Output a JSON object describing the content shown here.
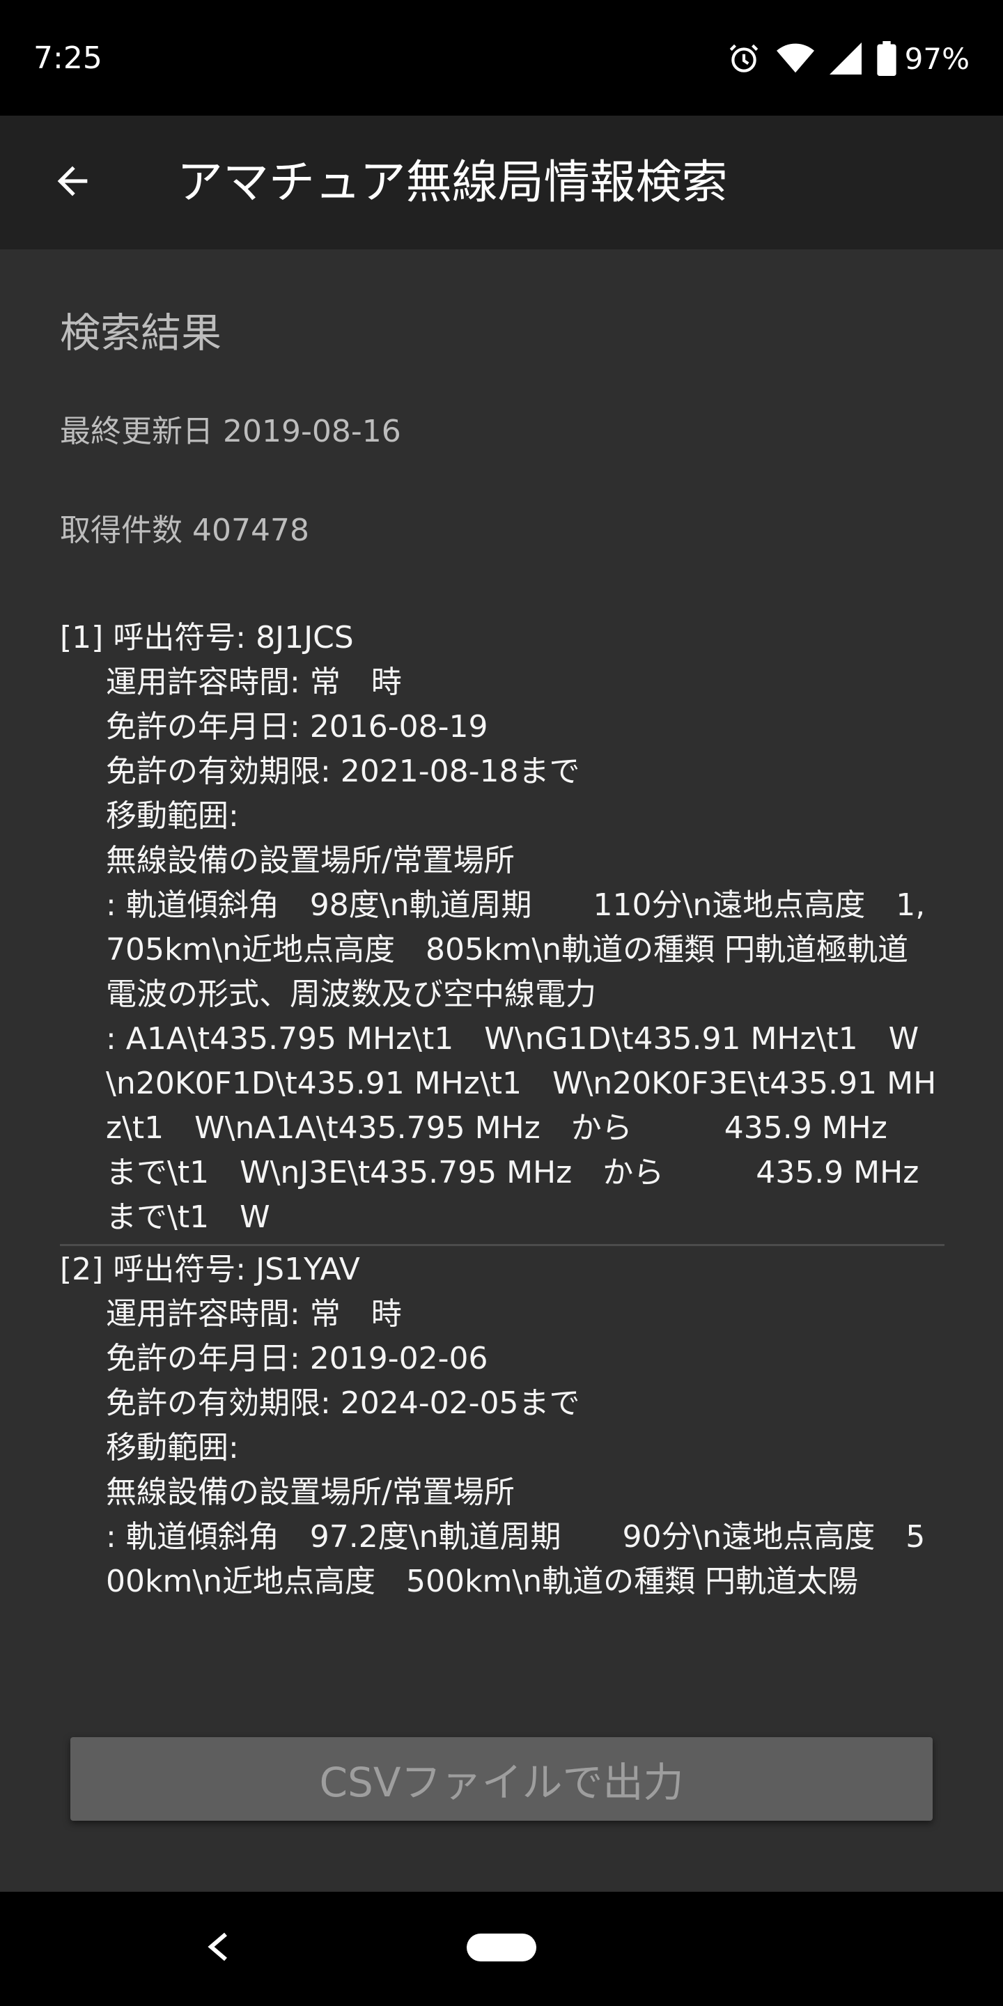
{
  "status_bar": {
    "time": "7:25",
    "battery_percent": "97%",
    "icons": [
      "alarm-icon",
      "wifi-icon",
      "cell-signal-icon",
      "battery-icon"
    ]
  },
  "app_bar": {
    "title": "アマチュア無線局情報検索",
    "back_icon": "arrow-back-icon"
  },
  "content": {
    "section_title": "検索結果",
    "last_updated": "最終更新日 2019-08-16",
    "result_count": "取得件数 407478"
  },
  "results": [
    {
      "header": "[1] 呼出符号: 8J1JCS",
      "operating_hours": "運用許容時間: 常　時",
      "license_date": "免許の年月日: 2016-08-19",
      "expiry": "免許の有効期限: 2021-08-18まで",
      "movement_range": "移動範囲:",
      "location_label": "無線設備の設置場所/常置場所",
      "location_value": ": 軌道傾斜角　98度\\n軌道周期　　110分\\n遠地点高度　1,705km\\n近地点高度　805km\\n軌道の種類 円軌道極軌道",
      "radio_label": "電波の形式、周波数及び空中線電力",
      "radio_value": ": A1A\\t435.795 MHz\\t1　W\\nG1D\\t435.91 MHz\\t1　W\\n20K0F1D\\t435.91 MHz\\t1　W\\n20K0F3E\\t435.91 MHz\\t1　W\\nA1A\\t435.795 MHz　から　　　435.9 MHz　まで\\t1　W\\nJ3E\\t435.795 MHz　から　　　435.9 MHz　まで\\t1　W"
    },
    {
      "header": "[2] 呼出符号: JS1YAV",
      "operating_hours": "運用許容時間: 常　時",
      "license_date": "免許の年月日: 2019-02-06",
      "expiry": "免許の有効期限: 2024-02-05まで",
      "movement_range": "移動範囲:",
      "location_label": "無線設備の設置場所/常置場所",
      "location_value": ": 軌道傾斜角　97.2度\\n軌道周期　　90分\\n遠地点高度　500km\\n近地点高度　500km\\n軌道の種類 円軌道太陽"
    }
  ],
  "csv_button": {
    "label": "CSVファイルで出力"
  },
  "nav_bar": {
    "icons": [
      "nav-back-icon",
      "nav-home-pill"
    ]
  },
  "colors": {
    "status_bar_bg": "#000000",
    "app_bar_bg": "#212121",
    "content_bg": "#2f2f2f",
    "secondary_text": "#bdbdbd",
    "button_bg": "#5e5e5e",
    "button_text": "#9e9e9e"
  }
}
